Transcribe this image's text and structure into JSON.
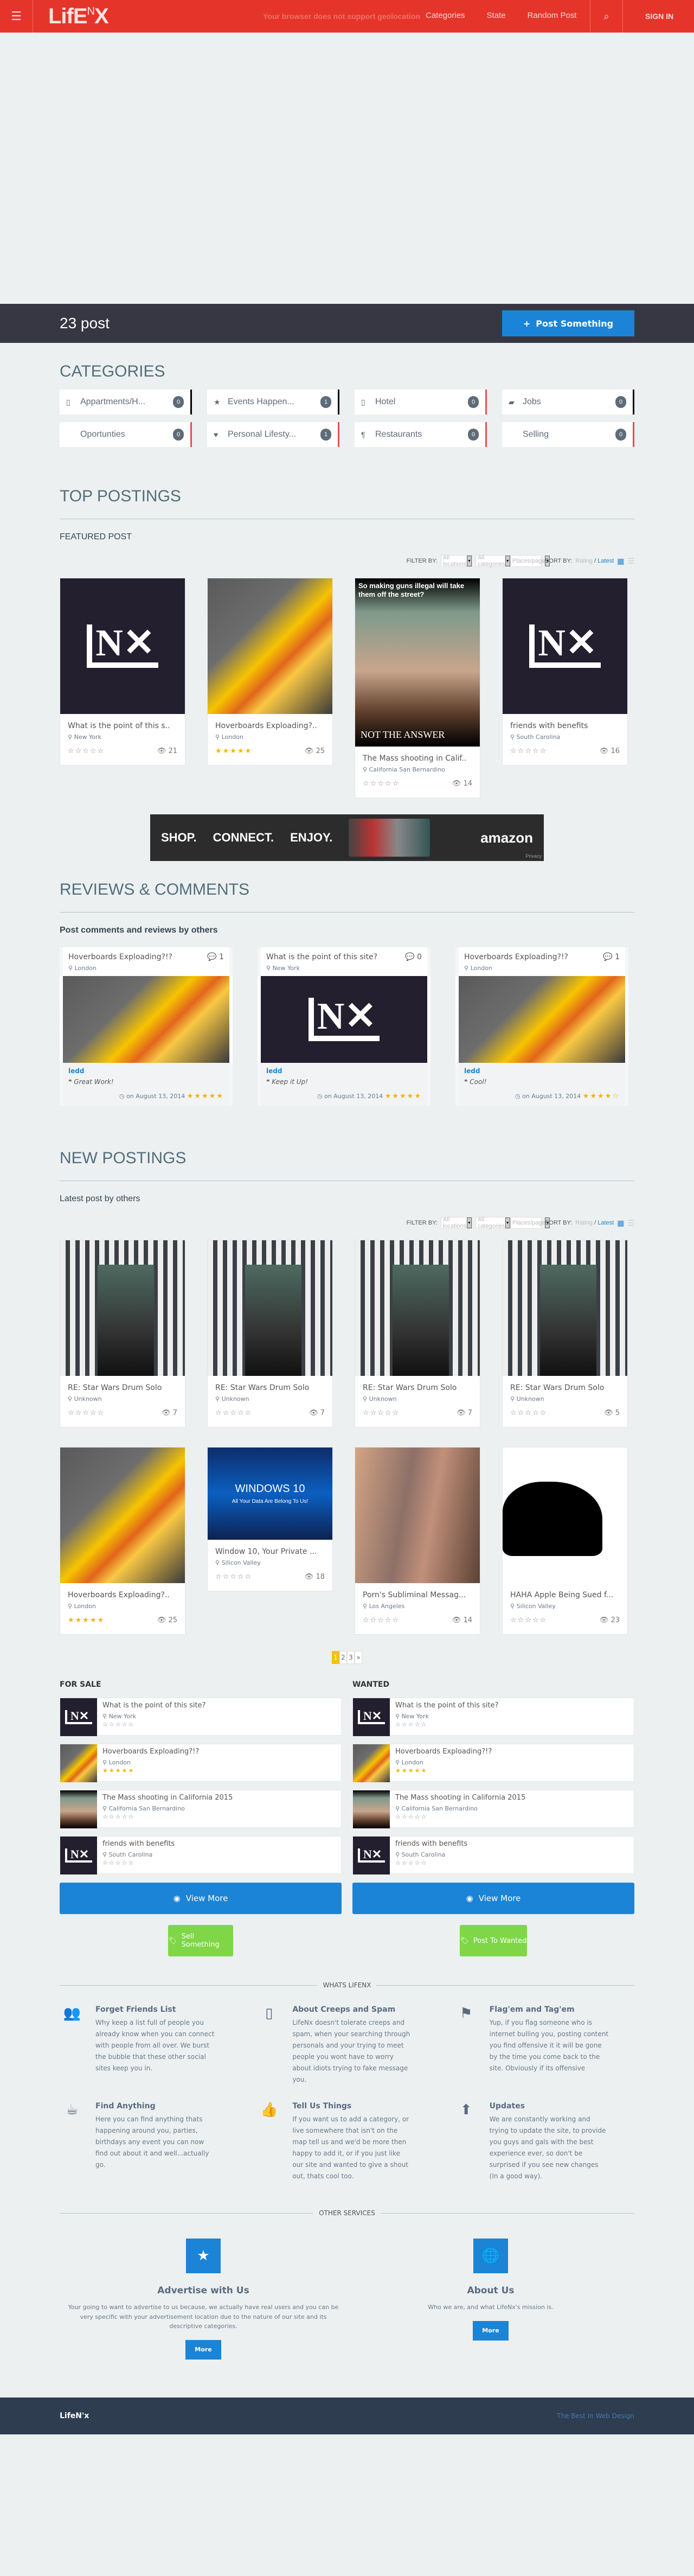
{
  "header": {
    "logo_main": "LifE",
    "logo_sup": "N",
    "logo_x": "X",
    "geo_message": "Your browser does not support geolocation",
    "nav": [
      "Categories",
      "State",
      "Random Post"
    ],
    "sign_in": "SIGN IN",
    "menu_icon": "hamburger-icon",
    "search_icon": "search-icon"
  },
  "postbar": {
    "count": "23 post",
    "button": "Post Something"
  },
  "categories": {
    "title": "CATEGORIES",
    "items": [
      {
        "label": "Appartments/H...",
        "count": "0",
        "icon": "▯",
        "accent": "#000000"
      },
      {
        "label": "Events Happen...",
        "count": "1",
        "icon": "★",
        "accent": "#000000"
      },
      {
        "label": "Hotel",
        "count": "0",
        "icon": "▯",
        "accent": "#e05255"
      },
      {
        "label": "Jobs",
        "count": "0",
        "icon": "▰",
        "accent": "#000000"
      },
      {
        "label": "Oportunties",
        "count": "0",
        "icon": "",
        "accent": "#e05255"
      },
      {
        "label": "Personal Lifesty...",
        "count": "1",
        "icon": "♥",
        "accent": "#e05255"
      },
      {
        "label": "Restaurants",
        "count": "0",
        "icon": "¶",
        "accent": "#e05255"
      },
      {
        "label": "Selling",
        "count": "0",
        "icon": "",
        "accent": "#e05255"
      }
    ]
  },
  "filters": {
    "label": "FILTER BY:",
    "locations": "All locations",
    "categories": "All categories",
    "per_page": "Places/page",
    "sort_label": "SORT BY:",
    "sort_rating": "Rating",
    "sort_latest": "Latest"
  },
  "top": {
    "title": "TOP POSTINGS",
    "subtitle": "FEATURED POST",
    "cards": [
      {
        "title": "What is the point of this s..",
        "location": "New York",
        "rating": 0,
        "views": "21",
        "img": "lnx"
      },
      {
        "title": "Hoverboards Exploading?..",
        "location": "London",
        "rating": 5,
        "views": "25",
        "img": "fire"
      },
      {
        "title": "The Mass shooting in Calif..",
        "location": "California San Bernardino",
        "rating": 0,
        "views": "14",
        "img": "baby"
      },
      {
        "title": "friends with benefits",
        "location": "South Carolina",
        "rating": 0,
        "views": "16",
        "img": "lnx"
      }
    ],
    "meme_text": "So making guns illegal will take them off the street?",
    "meme_bottom": "NOT THE ANSWER"
  },
  "ad": {
    "slogan": [
      "SHOP.",
      "CONNECT.",
      "ENJOY."
    ],
    "brand": "amazon",
    "privacy": "Privacy"
  },
  "reviews": {
    "title": "REVIEWS & COMMENTS",
    "subtitle": "Post comments and reviews by others",
    "items": [
      {
        "title": "Hoverboards Exploading?!?",
        "location": "London",
        "comments": "1",
        "user": "ledd",
        "comment": "Great Work!",
        "date": "on August 13, 2014",
        "rating": 5,
        "img": "fire"
      },
      {
        "title": "What is the point of this site?",
        "location": "New York",
        "comments": "0",
        "user": "ledd",
        "comment": "Keep it Up!",
        "date": "on August 13, 2014",
        "rating": 5,
        "img": "lnx"
      },
      {
        "title": "Hoverboards Exploading?!?",
        "location": "London",
        "comments": "1",
        "user": "ledd",
        "comment": "Cool!",
        "date": "on August 13, 2014",
        "rating": 4,
        "img": "fire"
      }
    ]
  },
  "newposts": {
    "title": "NEW POSTINGS",
    "subtitle": "Latest post by others",
    "cards": [
      {
        "title": "RE: Star Wars Drum Solo",
        "location": "Unknown",
        "rating": 0,
        "views": "7",
        "img": "boba"
      },
      {
        "title": "RE: Star Wars Drum Solo",
        "location": "Unknown",
        "rating": 0,
        "views": "7",
        "img": "boba"
      },
      {
        "title": "RE: Star Wars Drum Solo",
        "location": "Unknown",
        "rating": 0,
        "views": "7",
        "img": "boba"
      },
      {
        "title": "RE: Star Wars Drum Solo",
        "location": "Unknown",
        "rating": 0,
        "views": "5",
        "img": "boba"
      },
      {
        "title": "Hoverboards Exploading?..",
        "location": "London",
        "rating": 5,
        "views": "25",
        "img": "fire"
      },
      {
        "title": "Window 10, Your Private ...",
        "location": "Silicon Valley",
        "rating": 0,
        "views": "18",
        "img": "win"
      },
      {
        "title": "Porn's Subliminal Messag...",
        "location": "Los Angeles",
        "rating": 0,
        "views": "14",
        "img": "skin"
      },
      {
        "title": "HAHA Apple Being Sued f...",
        "location": "Silicon Valley",
        "rating": 0,
        "views": "23",
        "img": "apple"
      }
    ],
    "win_title": "WINDOWS 10",
    "win_sub": "All Your Data Are Belong To Us!",
    "pages": [
      "1",
      "2",
      "3",
      "»"
    ],
    "current_page": "1"
  },
  "sale": {
    "title": "FOR SALE",
    "items": [
      {
        "title": "What is the point of this site?",
        "location": "New York",
        "rating": 0,
        "img": "lnx"
      },
      {
        "title": "Hoverboards Exploading?!?",
        "location": "London",
        "rating": 5,
        "img": "fire"
      },
      {
        "title": "The Mass shooting in California 2015",
        "location": "California San Bernardino",
        "rating": 0,
        "img": "baby"
      },
      {
        "title": "friends with benefits",
        "location": "South Carolina",
        "rating": 0,
        "img": "lnx"
      }
    ],
    "view_more": "View More",
    "action": "Sell Something"
  },
  "wanted": {
    "title": "WANTED",
    "items": [
      {
        "title": "What is the point of this site?",
        "location": "New York",
        "rating": 0,
        "img": "lnx"
      },
      {
        "title": "Hoverboards Exploading?!?",
        "location": "London",
        "rating": 5,
        "img": "fire"
      },
      {
        "title": "The Mass shooting in California 2015",
        "location": "California San Bernardino",
        "rating": 0,
        "img": "baby"
      },
      {
        "title": "friends with benefits",
        "location": "South Carolina",
        "rating": 0,
        "img": "lnx"
      }
    ],
    "view_more": "View More",
    "action": "Post To Wanted"
  },
  "whats": {
    "title": "WHATS LIFENX",
    "features": [
      {
        "icon": "users-icon",
        "glyph": "👥",
        "title": "Forget Friends List",
        "text": "Why keep a list full of people you already know when you can connect with people from all over. We burst the bubble that these other social sites keep you in."
      },
      {
        "icon": "missing-glyph-icon",
        "glyph": "▯",
        "title": "About Creeps and Spam",
        "text": "LifeNx doesn't tolerate creeps and spam, when your searching through personals and your trying to meet people you wont have to worry about idiots trying to fake message you."
      },
      {
        "icon": "flag-icon",
        "glyph": "⚑",
        "title": "Flag'em and Tag'em",
        "text": "Yup, if you flag someone who is internet bulling you, posting content you find offensive it it will be gone by the time you come back to the site. Obviously if its offensive"
      },
      {
        "icon": "beer-mug-icon",
        "glyph": "☕",
        "title": "Find Anything",
        "text": "Here you can find anything thats happening around you, parties, birthdays any event you can now find out about it and well...actually go."
      },
      {
        "icon": "thumbs-up-icon",
        "glyph": "👍",
        "title": "Tell Us Things",
        "text": "If you want us to add a category, or live somewhere that isn't on the map tell us and we'd be more then happy to add it, or if you just like our site and wanted to give a shout out, thats cool too."
      },
      {
        "icon": "arrow-up-icon",
        "glyph": "⬆",
        "title": "Updates",
        "text": "We are constantly working and trying to update the site, to provide you guys and gals with the best experience ever, so don't be surprised if you see new changes (In a good way)."
      }
    ]
  },
  "services": {
    "title": "OTHER SERVICES",
    "items": [
      {
        "icon": "star-icon",
        "glyph": "★",
        "title": "Advertise with Us",
        "text": "Your going to want to advertise to us because, we actually have real users and you can be very specific with your advertisement location due to the nature of our site and its descriptive categories.",
        "button": "More"
      },
      {
        "icon": "globe-icon",
        "glyph": "🌐",
        "title": "About Us",
        "text": "Who we are, and what LifeNx's mission is.",
        "button": "More"
      }
    ]
  },
  "footer": {
    "brand": "LifeN'x",
    "tagline": "The Best In Web Design"
  },
  "colors": {
    "header": "#e5352b",
    "primary": "#1b84d6",
    "green": "#7fd647",
    "star": "#f4b400",
    "dark": "#363743",
    "footer": "#2e3d4f"
  }
}
